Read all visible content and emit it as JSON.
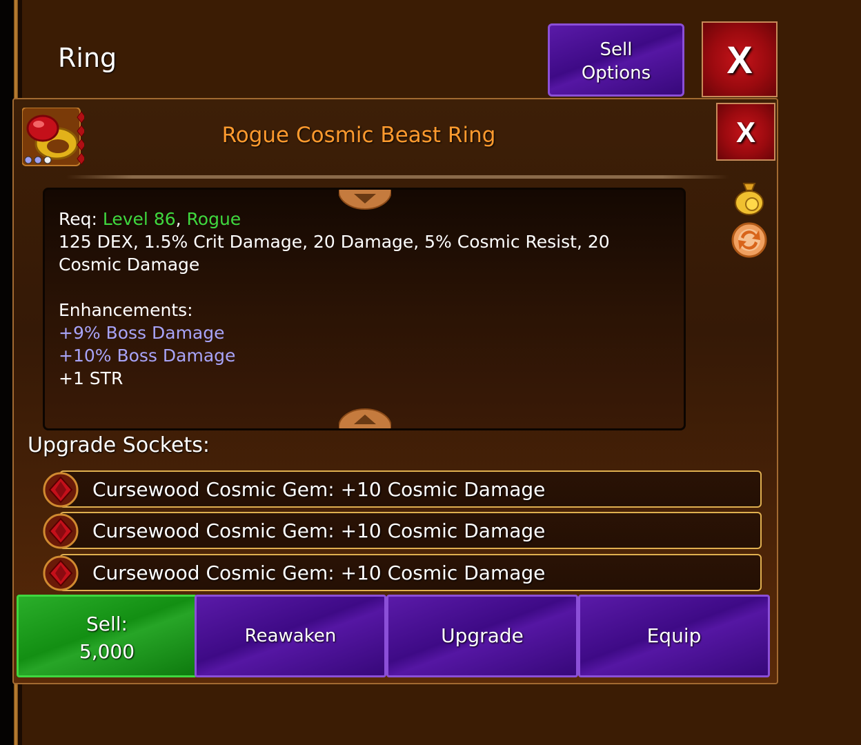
{
  "window": {
    "title": "Ring"
  },
  "header_buttons": {
    "sell_options_line1": "Sell",
    "sell_options_line2": "Options",
    "close_label": "X"
  },
  "item": {
    "name": "Rogue Cosmic Beast Ring",
    "close_label": "X",
    "icon": "gold-ring-red-gem-icon",
    "rarity_dots": 3
  },
  "description": {
    "req_label": "Req:",
    "req_level": "Level 86",
    "req_sep": ",",
    "req_class": "Rogue",
    "stats": "125 DEX, 1.5% Crit Damage, 20 Damage, 5% Cosmic Resist, 20 Cosmic Damage",
    "enhancements_label": "Enhancements:",
    "enhancements": [
      {
        "text": "+9% Boss Damage",
        "color": "#a8a4f8"
      },
      {
        "text": "+10% Boss Damage",
        "color": "#a8a4f8"
      },
      {
        "text": "+1 STR",
        "color": "#ffffff"
      }
    ]
  },
  "side_icons": [
    "money-bag-icon",
    "swap-arrows-icon"
  ],
  "sockets": {
    "label": "Upgrade Sockets:",
    "items": [
      {
        "text": "Cursewood Cosmic Gem: +10 Cosmic Damage"
      },
      {
        "text": "Cursewood Cosmic Gem: +10 Cosmic Damage"
      },
      {
        "text": "Cursewood Cosmic Gem: +10 Cosmic Damage"
      }
    ]
  },
  "actions": {
    "sell_label": "Sell:",
    "sell_price": "5,000",
    "reawaken": "Reawaken",
    "upgrade": "Upgrade",
    "equip": "Equip"
  },
  "colors": {
    "item_name": "#ff9a2e",
    "req_green": "#3fd83f",
    "enhancement_purple": "#a8a4f8",
    "button_purple": "#4a0f95",
    "button_green": "#1a9a1a",
    "button_red": "#b00f14"
  }
}
